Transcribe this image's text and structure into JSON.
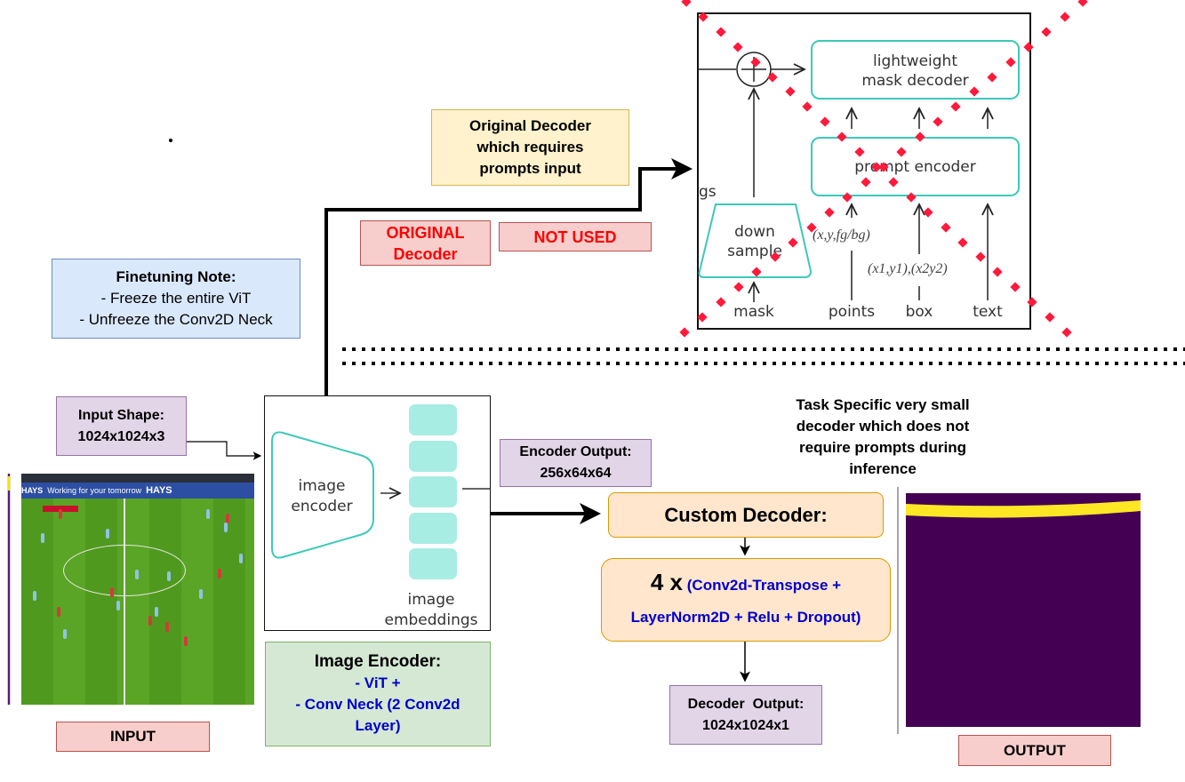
{
  "original_decoder_note": [
    "Original Decoder",
    "which requires",
    "prompts input"
  ],
  "original_decoder_label": [
    "ORIGINAL",
    "Decoder"
  ],
  "not_used_label": "NOT USED",
  "sam_decoder": {
    "lightweight_mask_decoder": [
      "lightweight",
      "mask decoder"
    ],
    "prompt_encoder": "prompt encoder",
    "down_sample": [
      "down",
      "sample"
    ],
    "embeddings_fragment": "gs",
    "points_format": "(x,y,fg/bg)",
    "box_format": "(x1,y1),(x2y2)",
    "inputs": [
      "mask",
      "points",
      "box",
      "text"
    ]
  },
  "finetuning_note": {
    "title": "Finetuning Note:",
    "lines": [
      "- Freeze the entire ViT",
      "- Unfreeze the Conv2D Neck"
    ]
  },
  "input_shape": {
    "title": "Input Shape:",
    "value": "1024x1024x3"
  },
  "input_image": {
    "banner_text": "HAYS",
    "banner_slogan": "Working for your tomorrow"
  },
  "input_label": "INPUT",
  "encoder_block": {
    "encoder_label": [
      "image",
      "encoder"
    ],
    "embeddings_label": [
      "image",
      "embeddings"
    ]
  },
  "image_encoder_note": {
    "title": "Image Encoder:",
    "lines": [
      "- ViT +",
      "- Conv Neck (2 Conv2d",
      "Layer)"
    ]
  },
  "encoder_output": {
    "title": "Encoder Output:",
    "value": "256x64x64"
  },
  "custom_decoder": {
    "title": "Custom Decoder:",
    "repeat": "4 x",
    "layers_1": "(Conv2d-Transpose +",
    "layers_2": "LayerNorm2D + Relu + Dropout)"
  },
  "decoder_output": {
    "title": "Decoder  Output:",
    "value": "1024x1024x1"
  },
  "task_specific_note": [
    "Task Specific very small",
    "decoder which does not",
    "require prompts during",
    "inference"
  ],
  "output_label": "OUTPUT",
  "colors": {
    "mask_background": "#440154",
    "mask_foreground": "#fde725",
    "strike_marks": "#ff1a3c",
    "layer_text": "#0000cc",
    "teal": "#3cc9b8"
  }
}
